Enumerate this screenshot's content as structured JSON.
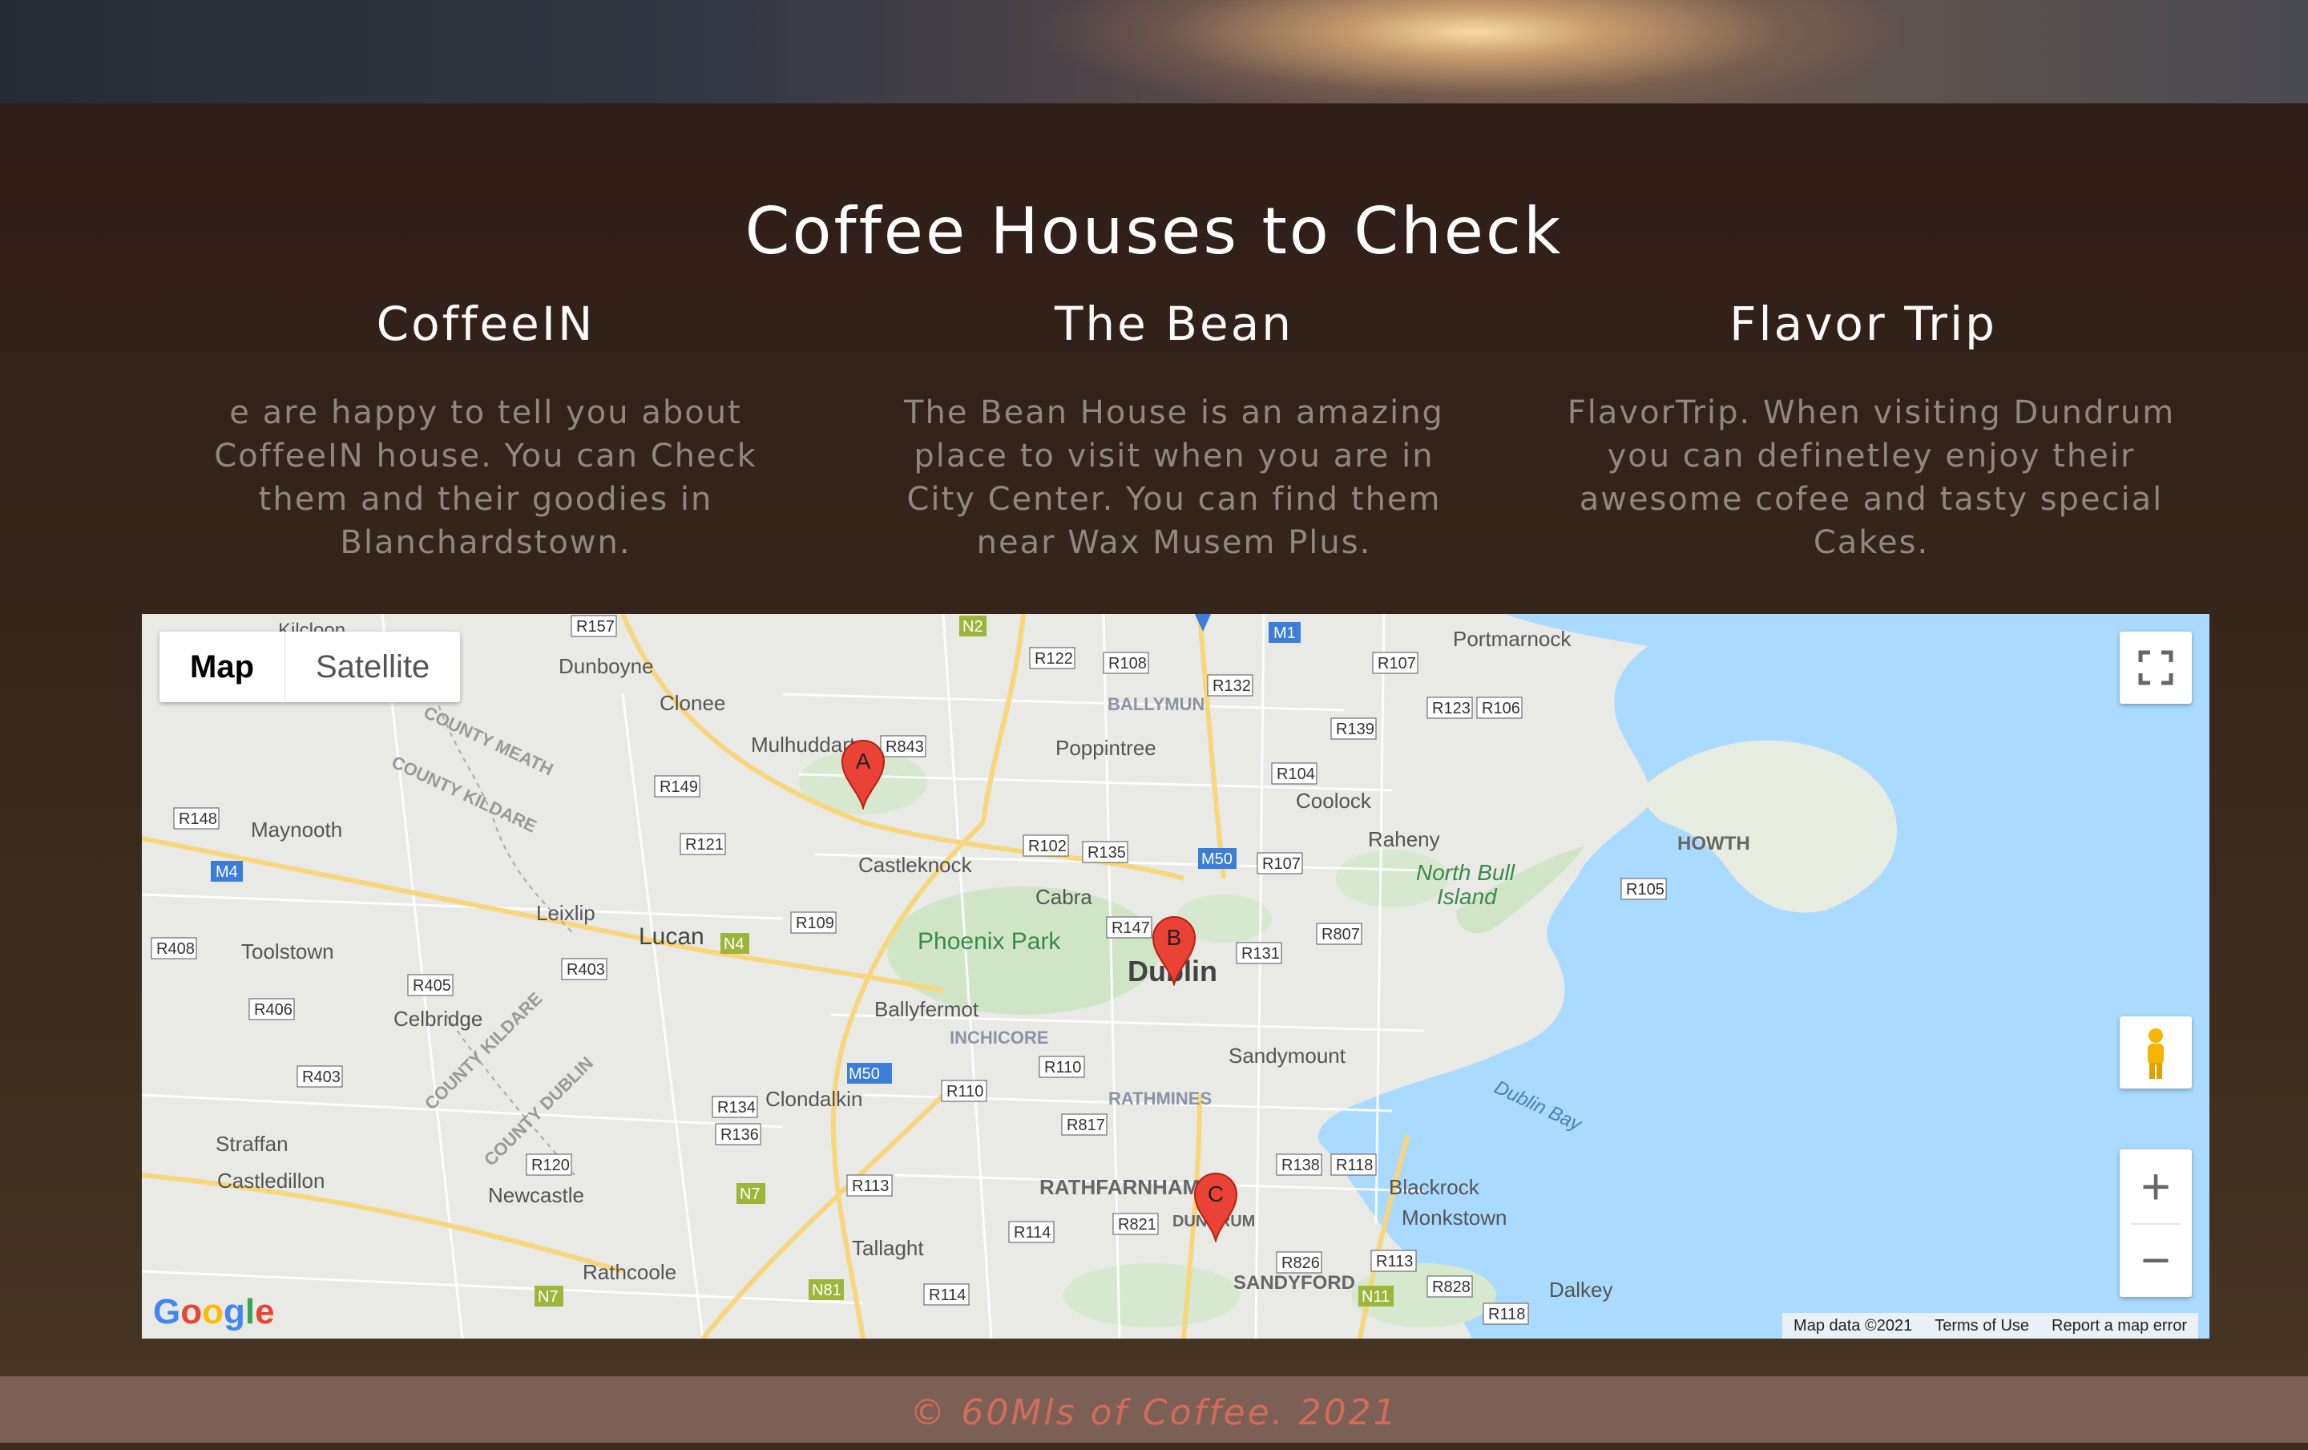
{
  "section": {
    "title": "Coffee Houses to Check"
  },
  "houses": [
    {
      "name": "CoffeeIN",
      "description": "e are happy to tell you about CoffeeIN house. You can Check them and their goodies in Blanchardstown."
    },
    {
      "name": "The Bean",
      "description": "The Bean House is an amazing place to visit when you are in City Center. You can find them near Wax Musem Plus."
    },
    {
      "name": "Flavor Trip",
      "description": "FlavorTrip. When visiting Dundrum you can definetley enjoy their awesome cofee and tasty special Cakes."
    }
  ],
  "map": {
    "type_control": {
      "map": "Map",
      "satellite": "Satellite"
    },
    "markers": [
      {
        "label": "A",
        "place": "Mulhuddart"
      },
      {
        "label": "B",
        "place": "Dublin"
      },
      {
        "label": "C",
        "place": "Dundrum"
      }
    ],
    "place_labels": [
      "Dunboyne",
      "Clonee",
      "Mulhuddart",
      "Poppintree",
      "BALLYMUN",
      "Portmarnock",
      "Coolock",
      "Maynooth",
      "Castleknock",
      "Raheny",
      "HOWTH",
      "North Bull Island",
      "Cabra",
      "Leixlip",
      "Lucan",
      "Phoenix Park",
      "Dublin",
      "Toolstown",
      "Celbridge",
      "Ballyfermot",
      "INCHICORE",
      "Sandymount",
      "RATHMINES",
      "Dublin Bay",
      "Clondalkin",
      "Straffan",
      "Castledillon",
      "Newcastle",
      "RATHFARNHAM",
      "DUNDRUM",
      "Blackrock",
      "Monkstown",
      "Tallaght",
      "Rathcoole",
      "SANDYFORD",
      "Dalkey",
      "COUNTY MEATH",
      "COUNTY KILDARE",
      "COUNTY DUBLIN",
      "Kilcloon"
    ],
    "road_labels": [
      "R157",
      "N2",
      "M1",
      "R122",
      "R108",
      "R132",
      "R107",
      "R123",
      "R106",
      "R843",
      "R139",
      "R149",
      "R104",
      "R148",
      "R121",
      "R102",
      "R135",
      "M50",
      "R107",
      "M4",
      "R105",
      "R109",
      "R147",
      "R807",
      "R131",
      "R408",
      "N4",
      "R405",
      "R403",
      "R406",
      "R110",
      "R403",
      "R134",
      "R136",
      "R817",
      "R120",
      "R138",
      "R118",
      "R113",
      "N7",
      "R821",
      "R114",
      "R826",
      "R113",
      "R828",
      "R114",
      "N81",
      "N7",
      "N11",
      "R118"
    ],
    "attribution": {
      "data": "Map data ©2021",
      "terms": "Terms of Use",
      "report": "Report a map error"
    },
    "logo": {
      "g1": "G",
      "g2": "o",
      "g3": "o",
      "g4": "g",
      "g5": "l",
      "g6": "e"
    },
    "zoom_in": "+",
    "zoom_out": "−"
  },
  "footer": {
    "text": "© 60Mls of Coffee. 2021"
  },
  "colors": {
    "title": "#ffffff",
    "description": "#8e8882",
    "footer_bg": "#7c5f55",
    "footer_text": "#d26c5a",
    "water": "#aadaff",
    "marker": "#ea4335"
  }
}
